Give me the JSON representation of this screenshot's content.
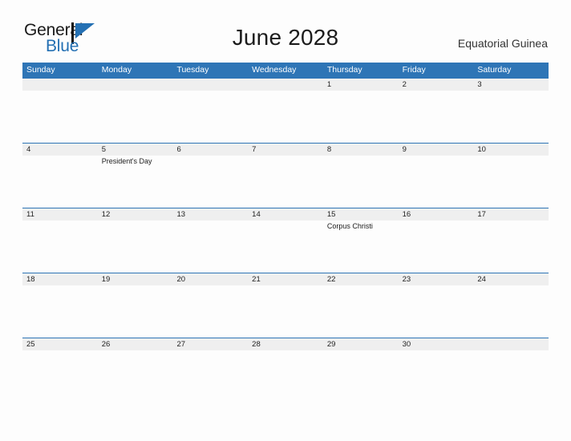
{
  "brand": {
    "name_part1": "General",
    "name_part2": "Blue",
    "mark_name": "blue-pennant-logo-mark",
    "color_dark": "#1a1a1a",
    "color_blue": "#2470b3"
  },
  "header": {
    "title": "June 2028",
    "subtitle": "Equatorial Guinea"
  },
  "calendar": {
    "accent_color": "#2e75b6",
    "daynum_band_color": "#efefef",
    "weekdays": [
      "Sunday",
      "Monday",
      "Tuesday",
      "Wednesday",
      "Thursday",
      "Friday",
      "Saturday"
    ],
    "weeks": [
      [
        {
          "day": "",
          "event": ""
        },
        {
          "day": "",
          "event": ""
        },
        {
          "day": "",
          "event": ""
        },
        {
          "day": "",
          "event": ""
        },
        {
          "day": "1",
          "event": ""
        },
        {
          "day": "2",
          "event": ""
        },
        {
          "day": "3",
          "event": ""
        }
      ],
      [
        {
          "day": "4",
          "event": ""
        },
        {
          "day": "5",
          "event": "President's Day"
        },
        {
          "day": "6",
          "event": ""
        },
        {
          "day": "7",
          "event": ""
        },
        {
          "day": "8",
          "event": ""
        },
        {
          "day": "9",
          "event": ""
        },
        {
          "day": "10",
          "event": ""
        }
      ],
      [
        {
          "day": "11",
          "event": ""
        },
        {
          "day": "12",
          "event": ""
        },
        {
          "day": "13",
          "event": ""
        },
        {
          "day": "14",
          "event": ""
        },
        {
          "day": "15",
          "event": "Corpus Christi"
        },
        {
          "day": "16",
          "event": ""
        },
        {
          "day": "17",
          "event": ""
        }
      ],
      [
        {
          "day": "18",
          "event": ""
        },
        {
          "day": "19",
          "event": ""
        },
        {
          "day": "20",
          "event": ""
        },
        {
          "day": "21",
          "event": ""
        },
        {
          "day": "22",
          "event": ""
        },
        {
          "day": "23",
          "event": ""
        },
        {
          "day": "24",
          "event": ""
        }
      ],
      [
        {
          "day": "25",
          "event": ""
        },
        {
          "day": "26",
          "event": ""
        },
        {
          "day": "27",
          "event": ""
        },
        {
          "day": "28",
          "event": ""
        },
        {
          "day": "29",
          "event": ""
        },
        {
          "day": "30",
          "event": ""
        },
        {
          "day": "",
          "event": ""
        }
      ]
    ]
  }
}
